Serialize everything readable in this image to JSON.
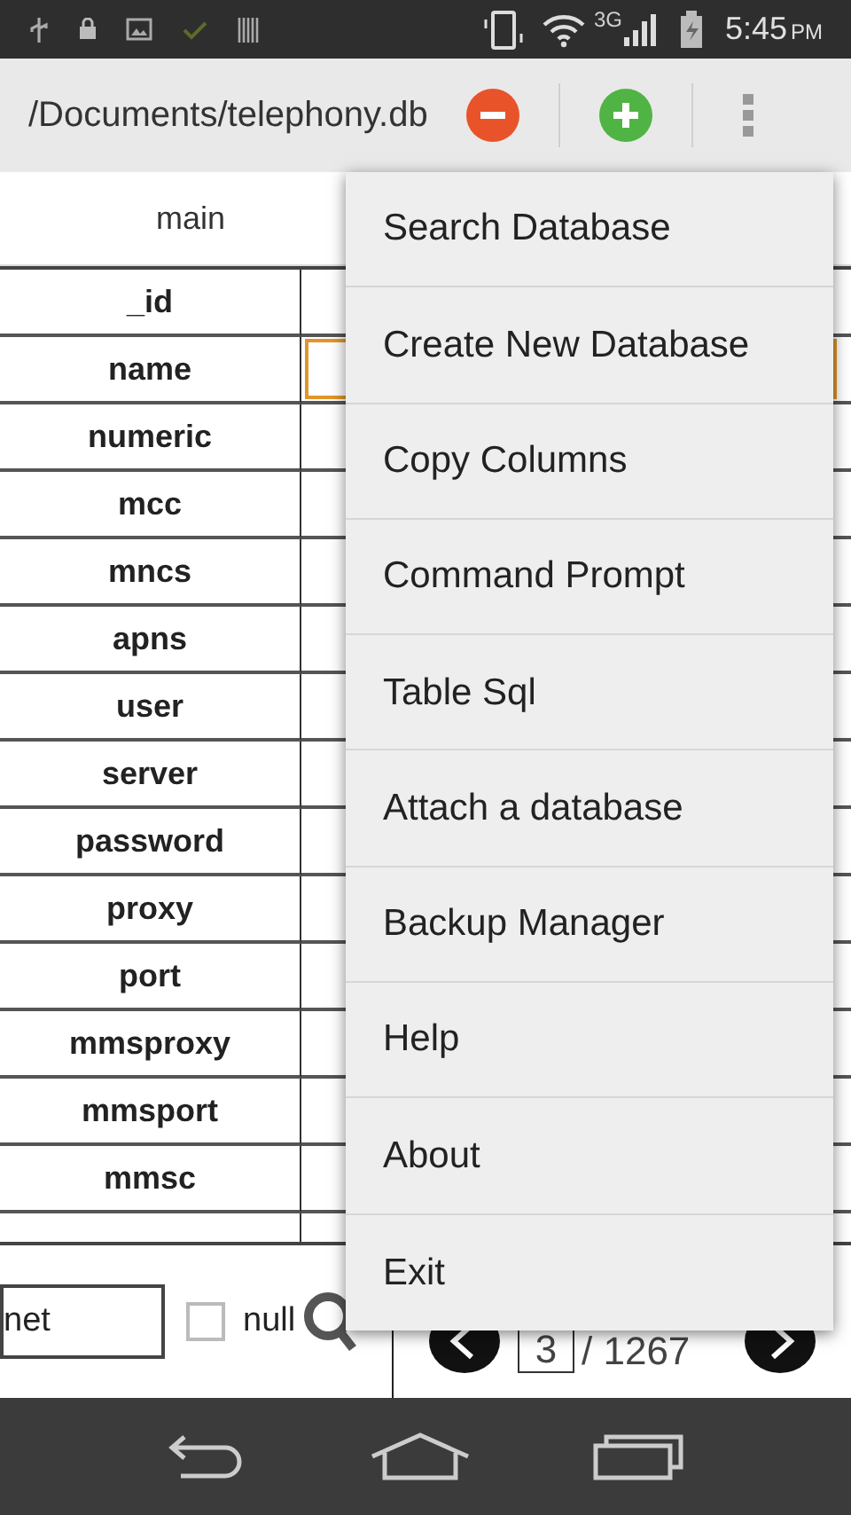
{
  "status_bar": {
    "time": "5:45",
    "ampm": "PM",
    "network": "3G"
  },
  "toolbar": {
    "path": "/Documents/telephony.db"
  },
  "table": {
    "name": "main",
    "rows": [
      {
        "column": "_id",
        "selected": false
      },
      {
        "column": "name",
        "selected": true
      },
      {
        "column": "numeric",
        "selected": false
      },
      {
        "column": "mcc",
        "selected": false
      },
      {
        "column": "mncs",
        "selected": false
      },
      {
        "column": "apns",
        "selected": false
      },
      {
        "column": "user",
        "selected": false
      },
      {
        "column": "server",
        "selected": false
      },
      {
        "column": "password",
        "selected": false
      },
      {
        "column": "proxy",
        "selected": false
      },
      {
        "column": "port",
        "selected": false
      },
      {
        "column": "mmsproxy",
        "selected": false
      },
      {
        "column": "mmsport",
        "selected": false
      },
      {
        "column": "mmsc",
        "selected": false
      }
    ]
  },
  "menu": {
    "items": [
      "Search Database",
      "Create New Database",
      "Copy Columns",
      "Command Prompt",
      "Table Sql",
      "Attach a database",
      "Backup Manager",
      "Help",
      "About",
      "Exit"
    ]
  },
  "bottom": {
    "value": "net",
    "null_checked": false,
    "null_label": "null",
    "page": "3",
    "total": "/ 1267"
  }
}
